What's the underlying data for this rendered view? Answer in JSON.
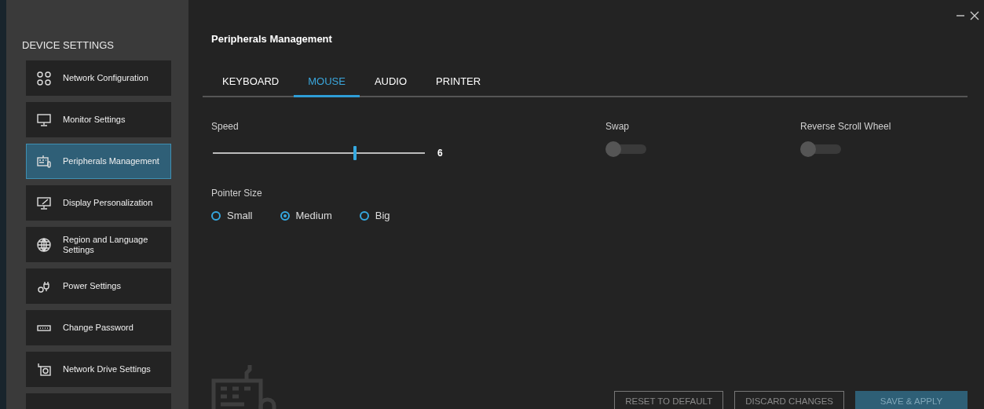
{
  "sidebar": {
    "heading": "DEVICE SETTINGS",
    "items": [
      {
        "label": "Network Configuration",
        "selected": false
      },
      {
        "label": "Monitor Settings",
        "selected": false
      },
      {
        "label": "Peripherals Management",
        "selected": true
      },
      {
        "label": "Display Personalization",
        "selected": false
      },
      {
        "label": "Region and Language Settings",
        "selected": false
      },
      {
        "label": "Power Settings",
        "selected": false
      },
      {
        "label": "Change Password",
        "selected": false
      },
      {
        "label": "Network Drive Settings",
        "selected": false
      }
    ]
  },
  "main": {
    "title": "Peripherals Management",
    "tabs": [
      {
        "label": "KEYBOARD",
        "selected": false
      },
      {
        "label": "MOUSE",
        "selected": true
      },
      {
        "label": "AUDIO",
        "selected": false
      },
      {
        "label": "PRINTER",
        "selected": false
      }
    ],
    "speed": {
      "label": "Speed",
      "level": 0.67,
      "reading": "6"
    },
    "toggles": [
      {
        "label": "Swap",
        "on": false
      },
      {
        "label": "Reverse Scroll Wheel",
        "on": false
      }
    ],
    "pointer_size": {
      "label": "Pointer Size",
      "options": [
        {
          "label": "Small",
          "selected": false
        },
        {
          "label": "Medium",
          "selected": true
        },
        {
          "label": "Big",
          "selected": false
        }
      ]
    },
    "buttons": [
      {
        "label": "RESET TO DEFAULT",
        "kind": "outline"
      },
      {
        "label": "DISCARD CHANGES",
        "kind": "outline"
      },
      {
        "label": "SAVE & APPLY",
        "kind": "primary"
      }
    ]
  }
}
